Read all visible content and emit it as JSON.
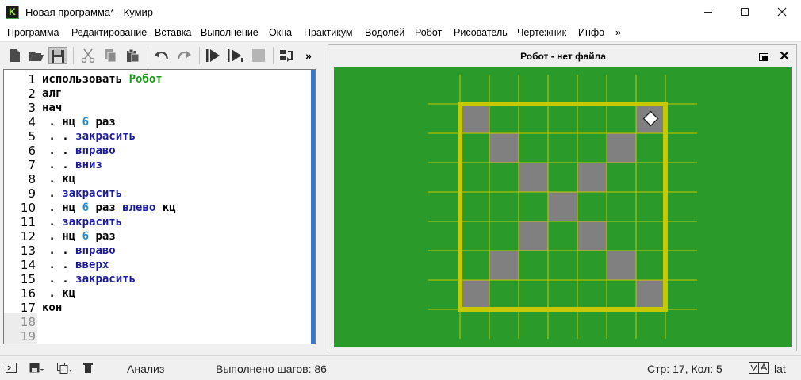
{
  "window": {
    "app_icon_letter": "K",
    "title": "Новая программа* - Кумир",
    "minimize_icon": "minimize-icon",
    "maximize_icon": "maximize-icon",
    "close_icon": "close-icon"
  },
  "menu": [
    "Программа",
    "Редактирование",
    "Вставка",
    "Выполнение",
    "Окна",
    "Практикум",
    "Водолей",
    "Робот",
    "Рисователь",
    "Чертежник",
    "Инфо",
    "»"
  ],
  "toolbar": {
    "icons": [
      "new-file-icon",
      "open-file-icon",
      "save-icon",
      "cut-icon",
      "copy-icon",
      "paste-icon",
      "undo-icon",
      "redo-icon",
      "run-icon",
      "step-run-icon",
      "stop-icon",
      "step-into-icon"
    ],
    "overflow": "»"
  },
  "editor": {
    "lines": [
      {
        "n": "1",
        "tokens": [
          {
            "t": "использовать ",
            "c": "kw"
          },
          {
            "t": "Робот",
            "c": "mod"
          }
        ]
      },
      {
        "n": "2",
        "tokens": [
          {
            "t": "алг",
            "c": "kw"
          }
        ]
      },
      {
        "n": "3",
        "tokens": [
          {
            "t": "нач",
            "c": "kw"
          }
        ]
      },
      {
        "n": "4",
        "tokens": [
          {
            "t": " . ",
            "c": "dot"
          },
          {
            "t": "нц ",
            "c": "kw"
          },
          {
            "t": "6",
            "c": "num"
          },
          {
            "t": " раз",
            "c": "kw"
          }
        ]
      },
      {
        "n": "5",
        "tokens": [
          {
            "t": " . . ",
            "c": "dot"
          },
          {
            "t": "закрасить",
            "c": "cmd"
          }
        ]
      },
      {
        "n": "6",
        "tokens": [
          {
            "t": " . . ",
            "c": "dot"
          },
          {
            "t": "вправо",
            "c": "cmd"
          }
        ]
      },
      {
        "n": "7",
        "tokens": [
          {
            "t": " . . ",
            "c": "dot"
          },
          {
            "t": "вниз",
            "c": "cmd"
          }
        ]
      },
      {
        "n": "8",
        "tokens": [
          {
            "t": " . ",
            "c": "dot"
          },
          {
            "t": "кц",
            "c": "kw"
          }
        ]
      },
      {
        "n": "9",
        "tokens": [
          {
            "t": " . ",
            "c": "dot"
          },
          {
            "t": "закрасить",
            "c": "cmd"
          }
        ]
      },
      {
        "n": "10",
        "tokens": [
          {
            "t": " . ",
            "c": "dot"
          },
          {
            "t": "нц ",
            "c": "kw"
          },
          {
            "t": "6",
            "c": "num"
          },
          {
            "t": " раз ",
            "c": "kw"
          },
          {
            "t": "влево",
            "c": "cmd"
          },
          {
            "t": " кц",
            "c": "kw"
          }
        ]
      },
      {
        "n": "11",
        "tokens": [
          {
            "t": " . ",
            "c": "dot"
          },
          {
            "t": "закрасить",
            "c": "cmd"
          }
        ]
      },
      {
        "n": "12",
        "tokens": [
          {
            "t": " . ",
            "c": "dot"
          },
          {
            "t": "нц ",
            "c": "kw"
          },
          {
            "t": "6",
            "c": "num"
          },
          {
            "t": " раз",
            "c": "kw"
          }
        ]
      },
      {
        "n": "13",
        "tokens": [
          {
            "t": " . . ",
            "c": "dot"
          },
          {
            "t": "вправо",
            "c": "cmd"
          }
        ]
      },
      {
        "n": "14",
        "tokens": [
          {
            "t": " . . ",
            "c": "dot"
          },
          {
            "t": "вверх",
            "c": "cmd"
          }
        ]
      },
      {
        "n": "15",
        "tokens": [
          {
            "t": " . . ",
            "c": "dot"
          },
          {
            "t": "закрасить",
            "c": "cmd"
          }
        ]
      },
      {
        "n": "16",
        "tokens": [
          {
            "t": " . ",
            "c": "dot"
          },
          {
            "t": "кц",
            "c": "kw"
          }
        ]
      },
      {
        "n": "17",
        "tokens": [
          {
            "t": "кон",
            "c": "kw"
          }
        ]
      },
      {
        "n": "18",
        "tokens": [],
        "empty": true
      },
      {
        "n": "19",
        "tokens": [],
        "empty": true
      }
    ]
  },
  "robot_panel": {
    "title": "Робот - нет файла",
    "field": {
      "cols": 7,
      "rows": 7,
      "painted": [
        [
          0,
          0
        ],
        [
          6,
          0
        ],
        [
          1,
          1
        ],
        [
          5,
          1
        ],
        [
          2,
          2
        ],
        [
          4,
          2
        ],
        [
          3,
          3
        ],
        [
          2,
          4
        ],
        [
          4,
          4
        ],
        [
          1,
          5
        ],
        [
          5,
          5
        ],
        [
          0,
          6
        ],
        [
          6,
          6
        ]
      ],
      "robot": [
        6,
        0
      ],
      "colors": {
        "bg": "#2a9a2a",
        "grid": "#c8c800",
        "wall": "#c8c800",
        "painted": "#808080",
        "robot": "#ffffff"
      }
    }
  },
  "status": {
    "mode": "Анализ",
    "steps": "Выполнено шагов: 86",
    "position": "Стр: 17, Кол: 5",
    "layout": "lat"
  }
}
